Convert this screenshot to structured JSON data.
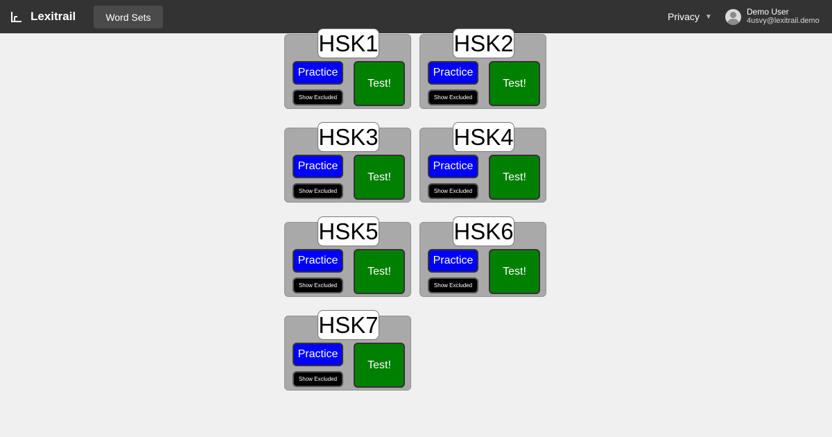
{
  "navbar": {
    "brand": "Lexitrail",
    "word_sets_label": "Word Sets",
    "privacy_label": "Privacy",
    "privacy_caret": "▼",
    "user_name": "Demo User",
    "user_email": "4usvy@lexitrail.demo"
  },
  "colors": {
    "navbar_bg": "#333333",
    "page_bg": "#f0f0f0",
    "card_bg": "#a9a9a9",
    "practice_bg": "#0000ff",
    "test_bg": "#008000",
    "excluded_bg": "#000000"
  },
  "word_sets": [
    {
      "title": "HSK1",
      "practice_label": "Practice",
      "excluded_label": "Show Excluded",
      "test_label": "Test!"
    },
    {
      "title": "HSK2",
      "practice_label": "Practice",
      "excluded_label": "Show Excluded",
      "test_label": "Test!"
    },
    {
      "title": "HSK3",
      "practice_label": "Practice",
      "excluded_label": "Show Excluded",
      "test_label": "Test!"
    },
    {
      "title": "HSK4",
      "practice_label": "Practice",
      "excluded_label": "Show Excluded",
      "test_label": "Test!"
    },
    {
      "title": "HSK5",
      "practice_label": "Practice",
      "excluded_label": "Show Excluded",
      "test_label": "Test!"
    },
    {
      "title": "HSK6",
      "practice_label": "Practice",
      "excluded_label": "Show Excluded",
      "test_label": "Test!"
    },
    {
      "title": "HSK7",
      "practice_label": "Practice",
      "excluded_label": "Show Excluded",
      "test_label": "Test!"
    }
  ]
}
